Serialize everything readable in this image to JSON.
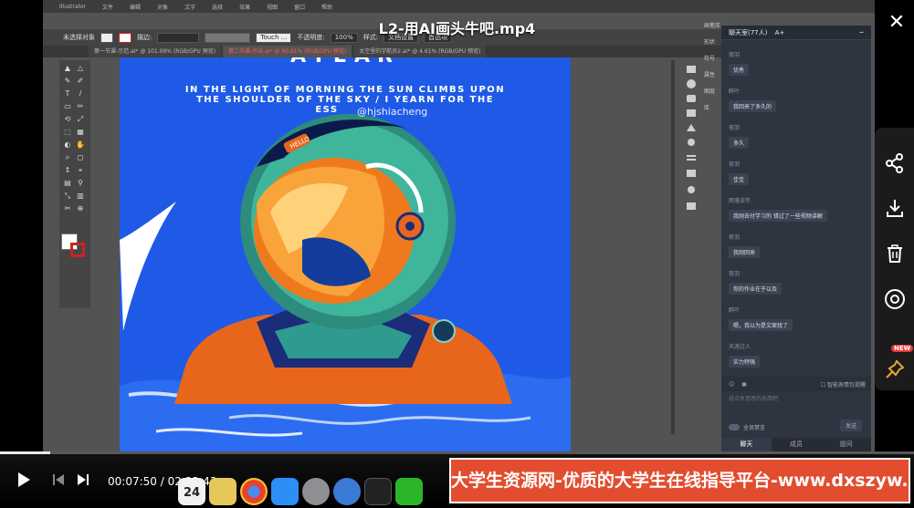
{
  "video": {
    "title": "L2-用AI画头牛吧.mp4",
    "current_time": "00:07:50",
    "duration": "02:22:43",
    "progress_fraction": 0.055
  },
  "illustrator": {
    "menu": [
      "Illustrator",
      "文件",
      "编辑",
      "对象",
      "文字",
      "选择",
      "效果",
      "视图",
      "窗口",
      "帮助"
    ],
    "control_bar": {
      "selection": "未选择对象",
      "stroke_label": "描边:",
      "style_select": "Touch ...",
      "opacity_label": "不透明度:",
      "opacity_value": "100%",
      "style_label": "样式:",
      "doc_settings": "文档设置",
      "preferences": "首选项"
    },
    "tabs": [
      {
        "label": "第一节课-示范.ai* @ 101.09% (RGB/GPU 预览)",
        "active": false
      },
      {
        "label": "第二节课-作业.ai* @ 90.91% (RGB/GPU 预览)",
        "active": true
      },
      {
        "label": "太空里的宇航员2.ai* @ 4.61% (RGB/GPU 预览)",
        "active": false
      }
    ],
    "panel_labels": [
      "画笔库",
      "形状",
      "符号",
      "属性",
      "图层",
      "库"
    ],
    "artboard": {
      "headline": "AYEAR",
      "poem_line1": "IN THE LIGHT OF MORNING THE SUN CLIMBS UPON",
      "poem_line2": "THE SHOULDER OF THE SKY / I YEARN FOR THE",
      "poem_line3": "ESS",
      "watermark": "@hjshiacheng",
      "helmet_label": "HELLO"
    }
  },
  "chat": {
    "header": "聊天室(77人)",
    "font_toggle": "A+",
    "messages": [
      {
        "name": "夜羽",
        "text": "优秀"
      },
      {
        "name": "醉叶",
        "text": "我回来了多久的"
      },
      {
        "name": "夜羽",
        "text": "多久"
      },
      {
        "name": "夜羽",
        "text": "佳佳"
      },
      {
        "name": "雨落流年",
        "text": "我刚去付学习的 错过了一些视频讲解"
      },
      {
        "name": "夜羽",
        "text": "我刚回来"
      },
      {
        "name": "夜羽",
        "text": "你的作业在于以及"
      },
      {
        "name": "醉叶",
        "text": "嗯，我以为是文案找了"
      },
      {
        "name": "天涯过人",
        "text": "实力特强"
      }
    ],
    "tools_check": "智能表情包提醒",
    "input_placeholder": "说点有意思的东西吧",
    "mute_label": "全员禁言",
    "send_label": "发送",
    "tabs": [
      "聊天",
      "成员",
      "提问"
    ],
    "active_tab": 0
  },
  "rail": {
    "icons": [
      "share-icon",
      "download-icon",
      "delete-icon",
      "target-icon",
      "pin-icon"
    ],
    "new_badge": "NEW"
  },
  "banner": {
    "text": "大学生资源网-优质的大学生在线指导平台-www.dxszyw.cn"
  },
  "dock_badge": "24",
  "colors": {
    "artboard_blue": "#1f5ae6",
    "banner_red": "#e24d2f",
    "chat_bg": "#2e3440",
    "new_badge": "#e53935"
  }
}
